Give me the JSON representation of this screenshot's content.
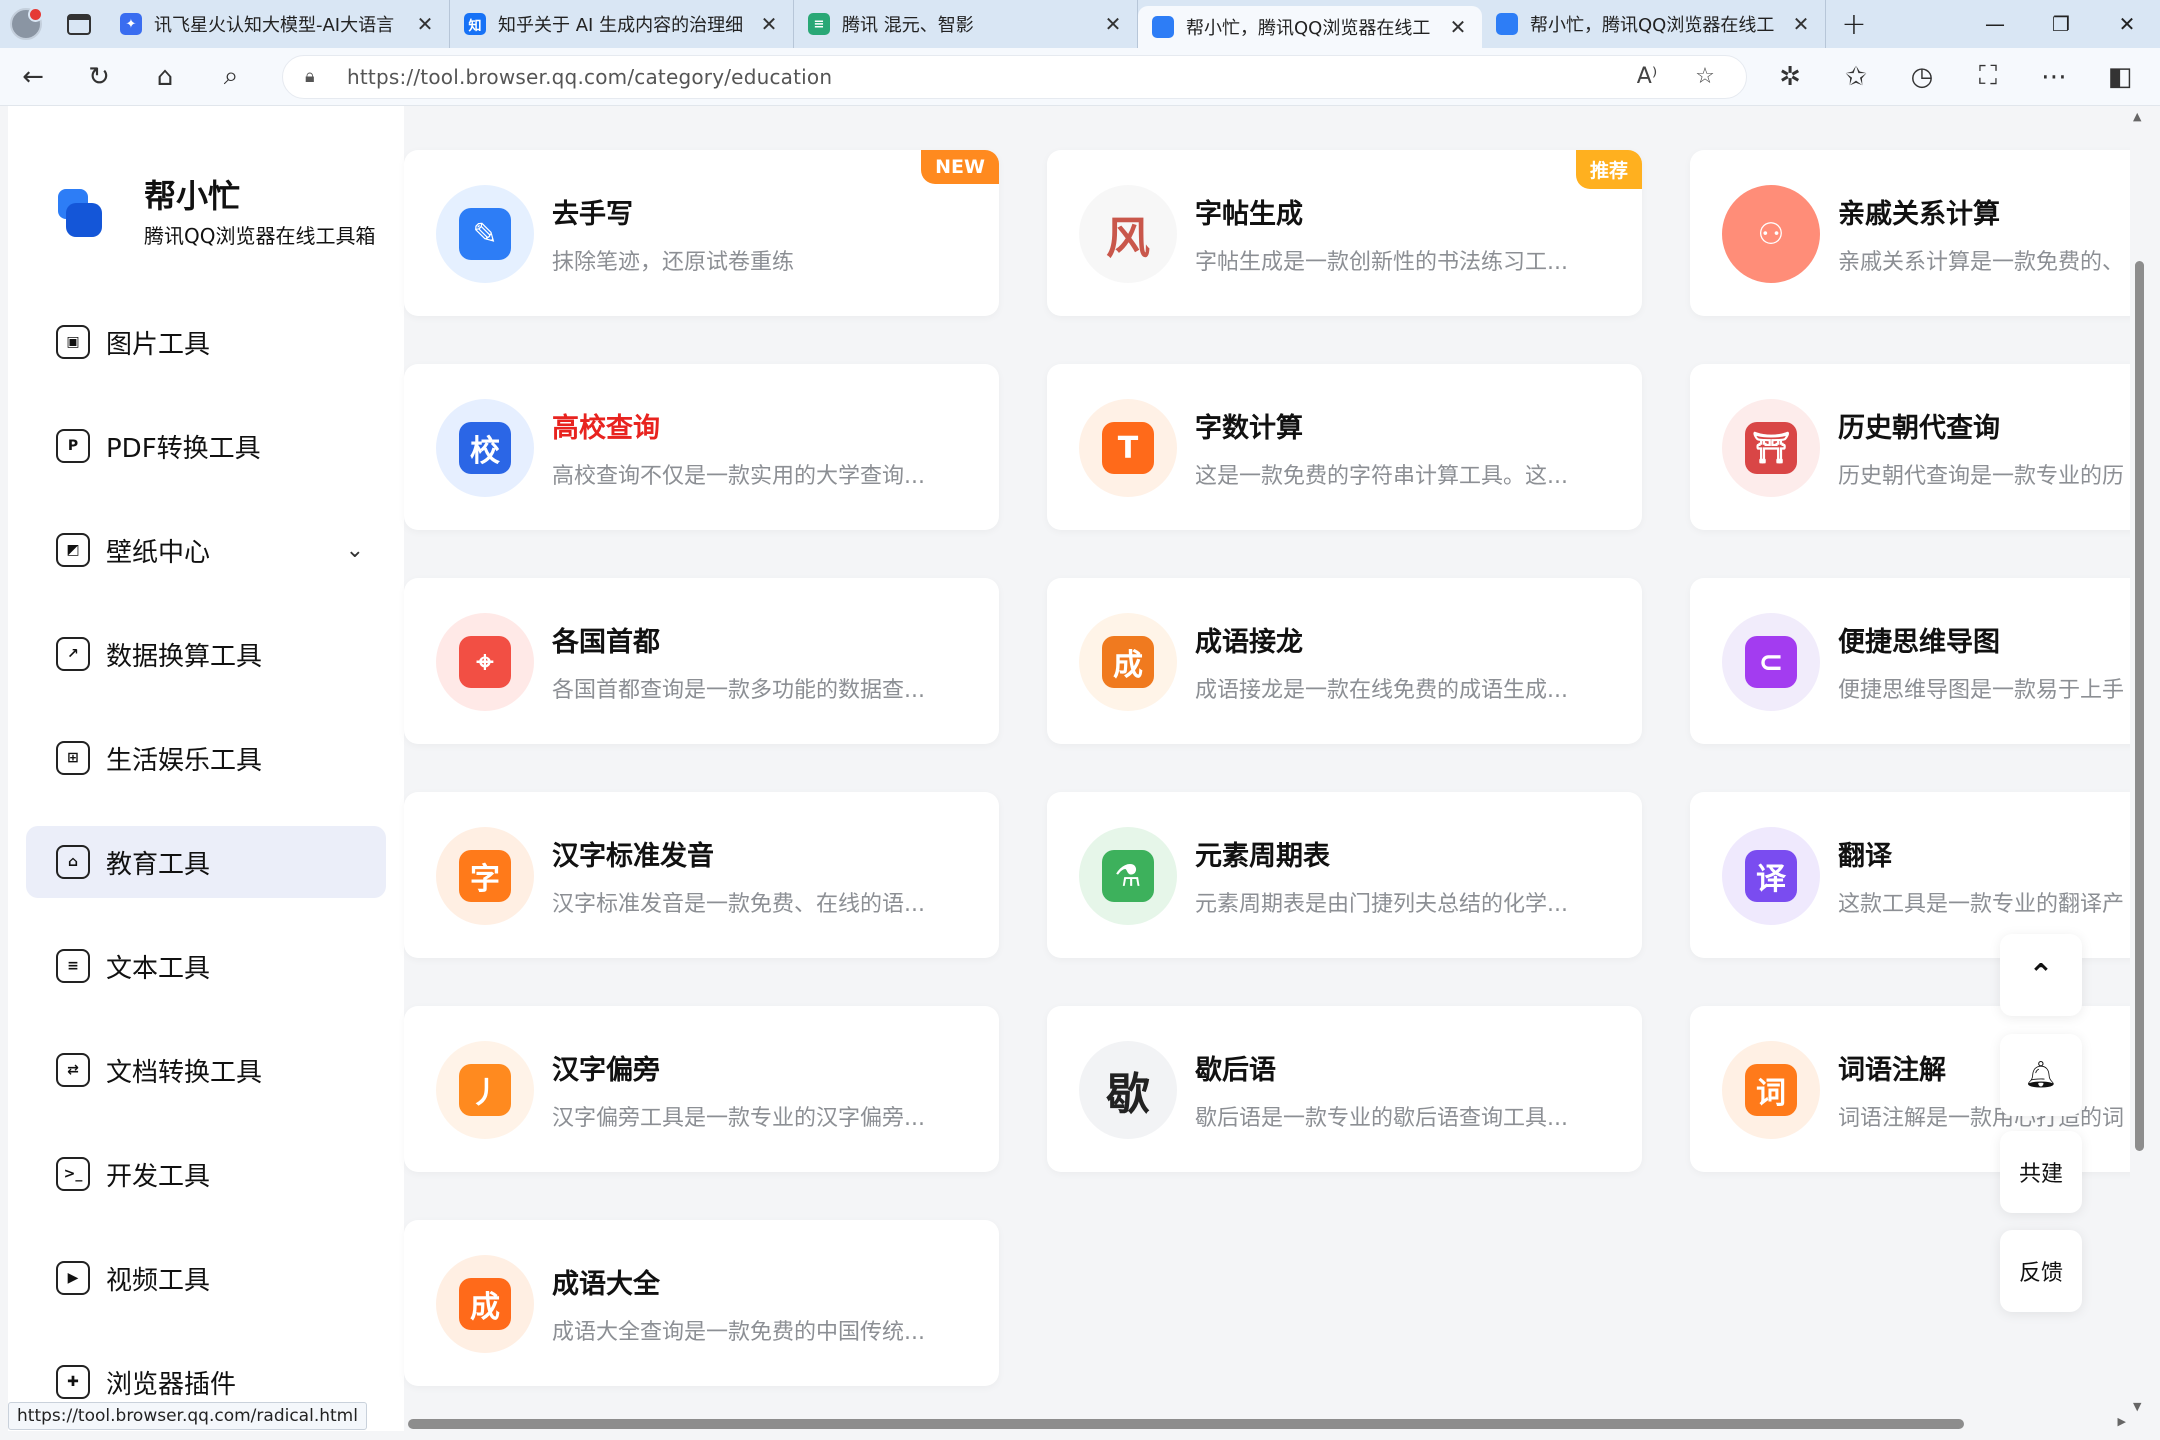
{
  "browser": {
    "tabs": [
      {
        "title": "讯飞星火认知大模型-AI大语言",
        "fav_color": "#3a6df0",
        "fav_text": "✦"
      },
      {
        "title": "知乎关于 AI 生成内容的治理细",
        "fav_color": "#1772f6",
        "fav_text": "知"
      },
      {
        "title": "腾讯 混元、智影",
        "fav_color": "#2aa876",
        "fav_text": "≡"
      },
      {
        "title": "帮小忙，腾讯QQ浏览器在线工",
        "fav_color": "#2d7df6",
        "fav_text": ""
      },
      {
        "title": "帮小忙，腾讯QQ浏览器在线工",
        "fav_color": "#2d7df6",
        "fav_text": ""
      }
    ],
    "url": "https://tool.browser.qq.com/category/education",
    "status_url": "https://tool.browser.qq.com/radical.html"
  },
  "site": {
    "name": "帮小忙",
    "subtitle": "腾讯QQ浏览器在线工具箱"
  },
  "menu": [
    {
      "label": "图片工具",
      "icon": "image-icon",
      "glyph": "▣",
      "active": false
    },
    {
      "label": "PDF转换工具",
      "icon": "pdf-icon",
      "glyph": "P",
      "active": false
    },
    {
      "label": "壁纸中心",
      "icon": "wallpaper-icon",
      "glyph": "◩",
      "active": false,
      "expandable": true
    },
    {
      "label": "数据换算工具",
      "icon": "data-chart-icon",
      "glyph": "↗",
      "active": false
    },
    {
      "label": "生活娱乐工具",
      "icon": "gamepad-icon",
      "glyph": "⊞",
      "active": false
    },
    {
      "label": "教育工具",
      "icon": "school-icon",
      "glyph": "⌂",
      "active": true
    },
    {
      "label": "文本工具",
      "icon": "text-doc-icon",
      "glyph": "≡",
      "active": false
    },
    {
      "label": "文档转换工具",
      "icon": "doc-convert-icon",
      "glyph": "⇄",
      "active": false
    },
    {
      "label": "开发工具",
      "icon": "terminal-icon",
      "glyph": ">_",
      "active": false
    },
    {
      "label": "视频工具",
      "icon": "video-icon",
      "glyph": "▶",
      "active": false
    },
    {
      "label": "浏览器插件",
      "icon": "puzzle-icon",
      "glyph": "✚",
      "active": false
    }
  ],
  "tools": [
    {
      "name": "去手写",
      "desc": "抹除笔迹，还原试卷重练",
      "badge": "NEW",
      "badge_color": "#ff8a1f",
      "icon": "eraser-icon",
      "glyph": "✎",
      "bg": "#e5f0ff",
      "fg": "#2d7df6",
      "red": false
    },
    {
      "name": "字帖生成",
      "desc": "字帖生成是一款创新性的书法练习工...",
      "badge": "推荐",
      "badge_color": "#ffb01f",
      "icon": "calligraphy-icon",
      "glyph": "风",
      "bg": "#f7f7f7",
      "fg": "#c9574b",
      "red": false
    },
    {
      "name": "亲戚关系计算",
      "desc": "亲戚关系计算是一款免费的、",
      "badge": "",
      "badge_color": "",
      "icon": "family-icon",
      "glyph": "⚇",
      "bg": "#ff8d78",
      "fg": "#ff8d78",
      "red": false
    },
    {
      "name": "高校查询",
      "desc": "高校查询不仅是一款实用的大学查询...",
      "badge": "",
      "badge_color": "",
      "icon": "university-search-icon",
      "glyph": "校",
      "bg": "#e6efff",
      "fg": "#2b66e6",
      "red": true
    },
    {
      "name": "字数计算",
      "desc": "这是一款免费的字符串计算工具。这...",
      "badge": "",
      "badge_color": "",
      "icon": "word-count-icon",
      "glyph": "T",
      "bg": "#fff1e6",
      "fg": "#ff6a1a",
      "red": false
    },
    {
      "name": "历史朝代查询",
      "desc": "历史朝代查询是一款专业的历",
      "badge": "",
      "badge_color": "",
      "icon": "dynasty-icon",
      "glyph": "⛩",
      "bg": "#fdeceb",
      "fg": "#d94646",
      "red": false
    },
    {
      "name": "各国首都",
      "desc": "各国首都查询是一款多功能的数据查...",
      "badge": "",
      "badge_color": "",
      "icon": "map-pin-icon",
      "glyph": "⌖",
      "bg": "#ffe9e7",
      "fg": "#f24f44",
      "red": false
    },
    {
      "name": "成语接龙",
      "desc": "成语接龙是一款在线免费的成语生成...",
      "badge": "",
      "badge_color": "",
      "icon": "idiom-chain-icon",
      "glyph": "成",
      "bg": "#fff4e8",
      "fg": "#f07a1f",
      "red": false
    },
    {
      "name": "便捷思维导图",
      "desc": "便捷思维导图是一款易于上手",
      "badge": "",
      "badge_color": "",
      "icon": "mindmap-icon",
      "glyph": "⊂",
      "bg": "#f1ecfb",
      "fg": "#a33cf0",
      "red": false
    },
    {
      "name": "汉字标准发音",
      "desc": "汉字标准发音是一款免费、在线的语...",
      "badge": "",
      "badge_color": "",
      "icon": "pronunciation-icon",
      "glyph": "字",
      "bg": "#ffefe3",
      "fg": "#ff7a1a",
      "red": false
    },
    {
      "name": "元素周期表",
      "desc": "元素周期表是由门捷列夫总结的化学...",
      "badge": "",
      "badge_color": "",
      "icon": "periodic-table-icon",
      "glyph": "⚗",
      "bg": "#e6f6e9",
      "fg": "#3db15c",
      "red": false
    },
    {
      "name": "翻译",
      "desc": "这款工具是一款专业的翻译产",
      "badge": "",
      "badge_color": "",
      "icon": "translate-icon",
      "glyph": "译",
      "bg": "#efe9fd",
      "fg": "#7a4cf0",
      "red": false
    },
    {
      "name": "汉字偏旁",
      "desc": "汉字偏旁工具是一款专业的汉字偏旁...",
      "badge": "",
      "badge_color": "",
      "icon": "radical-icon",
      "glyph": "丿",
      "bg": "#fff3e8",
      "fg": "#ff8a1f",
      "red": false
    },
    {
      "name": "歇后语",
      "desc": "歇后语是一款专业的歇后语查询工具...",
      "badge": "",
      "badge_color": "",
      "icon": "xiehouyu-icon",
      "glyph": "歇",
      "bg": "#f2f3f5",
      "fg": "#222222",
      "red": false
    },
    {
      "name": "词语注解",
      "desc": "词语注解是一款用心打造的词",
      "badge": "",
      "badge_color": "",
      "icon": "word-note-icon",
      "glyph": "词",
      "bg": "#fff0e4",
      "fg": "#ff7a1a",
      "red": false
    },
    {
      "name": "成语大全",
      "desc": "成语大全查询是一款免费的中国传统...",
      "badge": "",
      "badge_color": "",
      "icon": "idiom-book-icon",
      "glyph": "成",
      "bg": "#ffefe3",
      "fg": "#ff6a1a",
      "red": false
    }
  ],
  "float": {
    "top_icon": "back-to-top-icon",
    "bell_icon": "bell-icon",
    "cobuild": "共建",
    "feedback": "反馈"
  }
}
